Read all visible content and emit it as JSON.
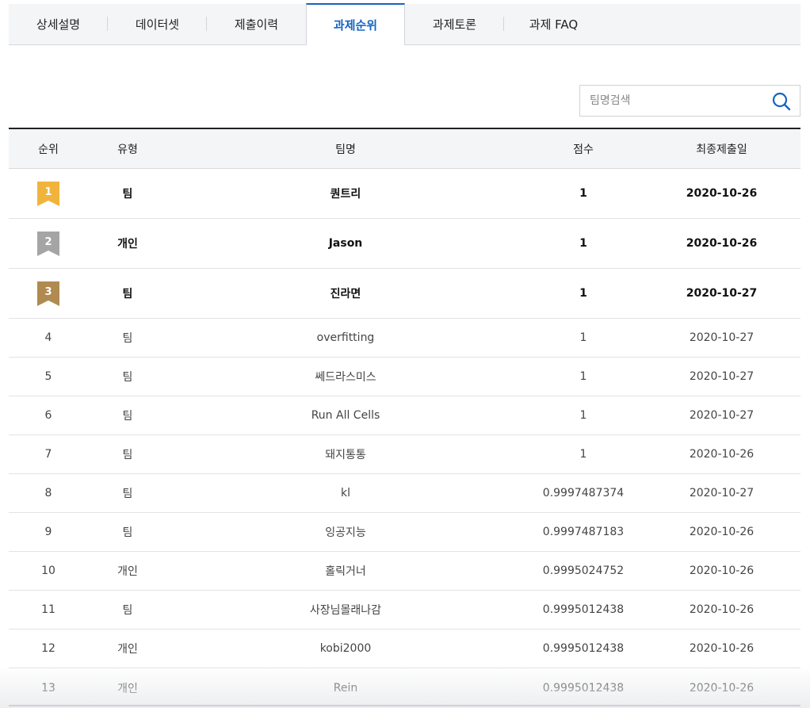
{
  "tabs": [
    {
      "label": "상세설명"
    },
    {
      "label": "데이터셋"
    },
    {
      "label": "제출이력"
    },
    {
      "label": "과제순위"
    },
    {
      "label": "과제토론"
    },
    {
      "label": "과제 FAQ"
    }
  ],
  "active_tab": "과제순위",
  "search": {
    "placeholder": "팀명검색",
    "value": ""
  },
  "table": {
    "headers": {
      "rank": "순위",
      "type": "유형",
      "team": "팀명",
      "score": "점수",
      "date": "최종제출일"
    },
    "top_rows": [
      {
        "rank": "1",
        "type": "팀",
        "team": "퀀트리",
        "score": "1",
        "date": "2020-10-26",
        "medal_color": "#f0b43c"
      },
      {
        "rank": "2",
        "type": "개인",
        "team": "Jason",
        "score": "1",
        "date": "2020-10-26",
        "medal_color": "#a5a5a5"
      },
      {
        "rank": "3",
        "type": "팀",
        "team": "진라면",
        "score": "1",
        "date": "2020-10-27",
        "medal_color": "#b08a50"
      }
    ],
    "rows": [
      {
        "rank": "4",
        "type": "팀",
        "team": "overfitting",
        "score": "1",
        "date": "2020-10-27"
      },
      {
        "rank": "5",
        "type": "팀",
        "team": "쎄드라스미스",
        "score": "1",
        "date": "2020-10-27"
      },
      {
        "rank": "6",
        "type": "팀",
        "team": "Run All Cells",
        "score": "1",
        "date": "2020-10-27"
      },
      {
        "rank": "7",
        "type": "팀",
        "team": "돼지통통",
        "score": "1",
        "date": "2020-10-26"
      },
      {
        "rank": "8",
        "type": "팀",
        "team": "kl",
        "score": "0.9997487374",
        "date": "2020-10-27"
      },
      {
        "rank": "9",
        "type": "팀",
        "team": "잉공지능",
        "score": "0.9997487183",
        "date": "2020-10-26"
      },
      {
        "rank": "10",
        "type": "개인",
        "team": "홀릭거너",
        "score": "0.9995024752",
        "date": "2020-10-26"
      },
      {
        "rank": "11",
        "type": "팀",
        "team": "사장님몰래나감",
        "score": "0.9995012438",
        "date": "2020-10-26"
      },
      {
        "rank": "12",
        "type": "개인",
        "team": "kobi2000",
        "score": "0.9995012438",
        "date": "2020-10-26"
      },
      {
        "rank": "13",
        "type": "개인",
        "team": "Rein",
        "score": "0.9995012438",
        "date": "2020-10-26"
      }
    ]
  },
  "colors": {
    "accent": "#1565c0",
    "header_bg": "#f4f5f7"
  },
  "icons": {
    "search": "search-icon",
    "medal": "ribbon-medal-icon"
  }
}
